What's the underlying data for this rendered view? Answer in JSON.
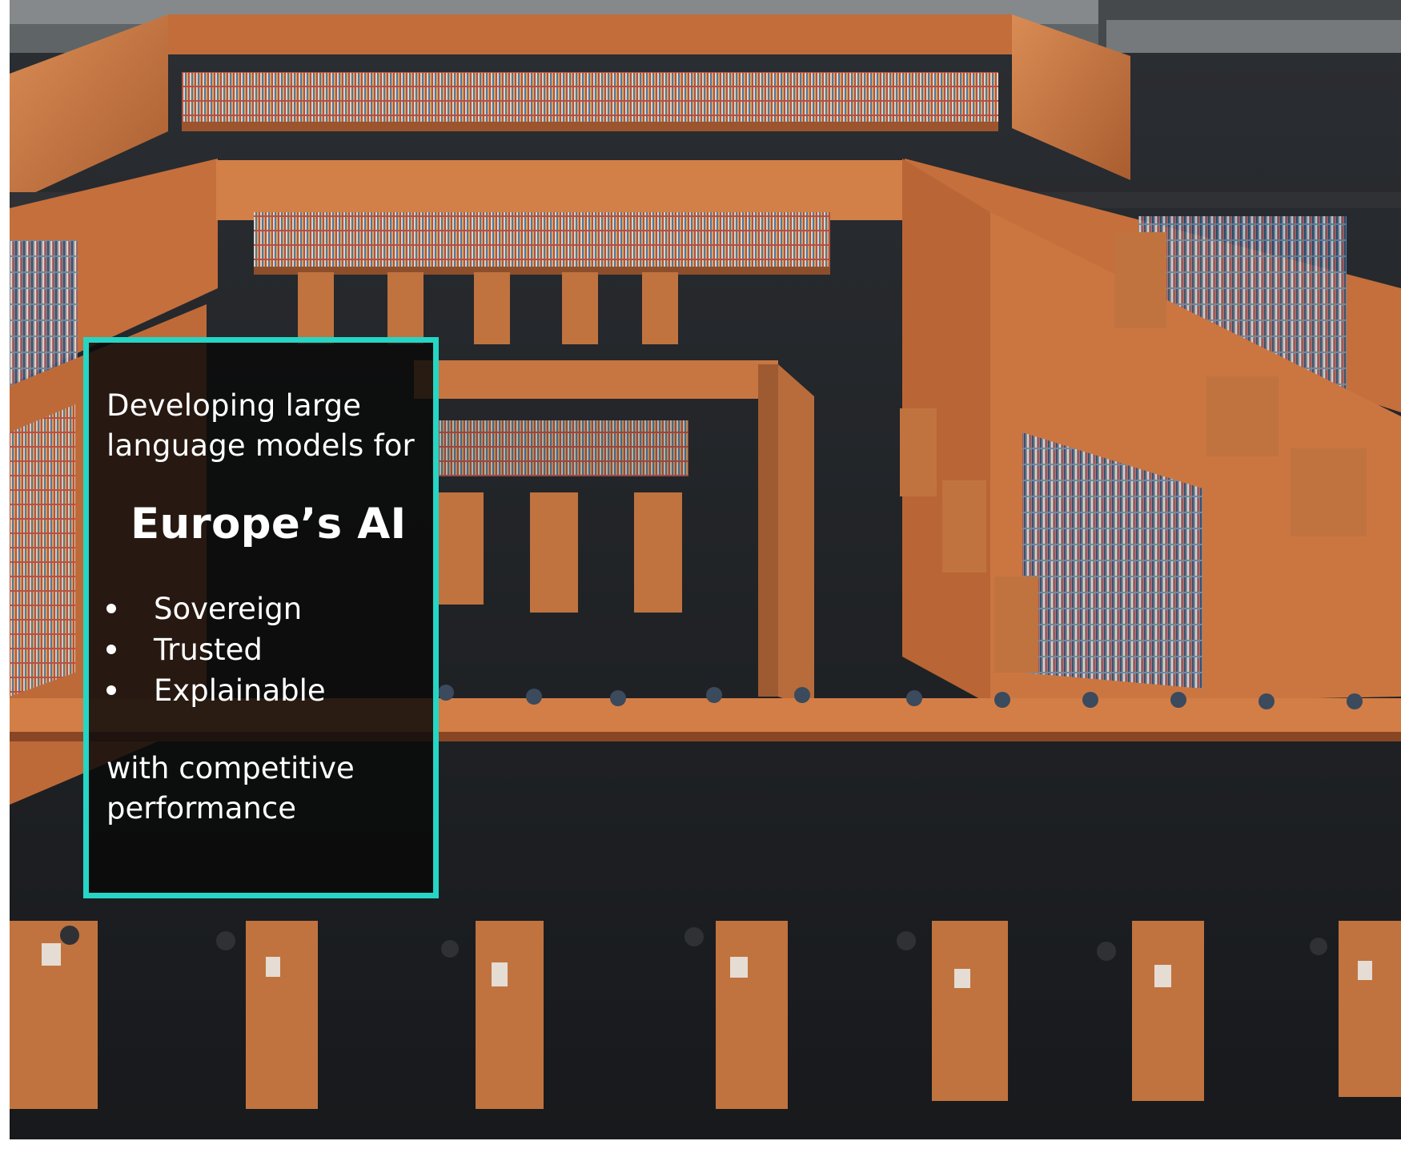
{
  "callout": {
    "intro_line_1": "Developing large",
    "intro_line_2": "language models for",
    "headline": "Europe’s AI",
    "bullets": [
      "Sovereign",
      "Trusted",
      "Explainable"
    ],
    "outro_line_1": "with competitive",
    "outro_line_2": "performance"
  },
  "colors": {
    "accent": "#26d5c4",
    "overlay_bg": "#0a0a0a",
    "wood": "#c87a45",
    "floor": "#24282b"
  }
}
